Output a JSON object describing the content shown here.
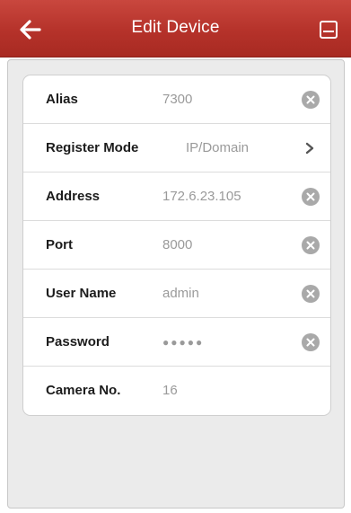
{
  "header": {
    "title": "Edit Device",
    "back_icon": "arrow-left-icon",
    "save_icon": "save-icon",
    "colors": {
      "bar": "#b5322a",
      "text": "#ffffff"
    }
  },
  "form": {
    "rows": [
      {
        "label": "Alias",
        "value": "7300",
        "control": "clear-icon"
      },
      {
        "label": "Register Mode",
        "value": "IP/Domain",
        "control": "chevron-right-icon"
      },
      {
        "label": "Address",
        "value": "172.6.23.105",
        "control": "clear-icon"
      },
      {
        "label": "Port",
        "value": "8000",
        "control": "clear-icon"
      },
      {
        "label": "User Name",
        "value": "admin",
        "control": "clear-icon"
      },
      {
        "label": "Password",
        "value": "●●●●●",
        "control": "clear-icon"
      },
      {
        "label": "Camera No.",
        "value": "16",
        "control": "none"
      }
    ]
  }
}
